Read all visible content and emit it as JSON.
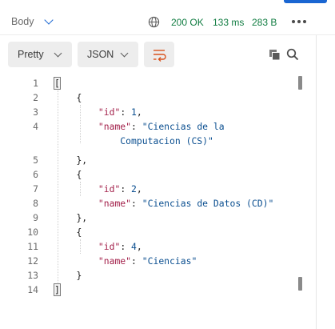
{
  "response_bar": {
    "body_tab_label": "Body",
    "status": "200 OK",
    "time": "133 ms",
    "size": "283 B",
    "icons": {
      "globe": "globe-icon",
      "more": "more-options-icon",
      "chevron": "chevron-down-icon"
    }
  },
  "toolbar": {
    "format_dropdown": "Pretty",
    "language_dropdown": "JSON",
    "icons": {
      "wrap": "wrap-lines-icon",
      "copy": "copy-icon",
      "search": "search-icon"
    }
  },
  "colors": {
    "accent_blue": "#1a66d2",
    "status_green": "#107c41",
    "json_key": "#a3214b",
    "json_value": "#0b4f90"
  },
  "editor": {
    "line_numbers": [
      "1",
      "2",
      "3",
      "4",
      "5",
      "6",
      "7",
      "8",
      "9",
      "10",
      "11",
      "12",
      "13",
      "14"
    ],
    "lines": [
      {
        "indent": "",
        "text": "["
      },
      {
        "indent": "    ",
        "text": "{"
      },
      {
        "indent": "        ",
        "key": "\"id\"",
        "sep": ": ",
        "value": "1",
        "end": ","
      },
      {
        "indent": "        ",
        "key": "\"name\"",
        "sep": ": ",
        "value": "\"Ciencias de la",
        "end": ""
      },
      {
        "indent": "            ",
        "text_value": "Computacion (CS)\""
      },
      {
        "indent": "    ",
        "text": "},"
      },
      {
        "indent": "    ",
        "text": "{"
      },
      {
        "indent": "        ",
        "key": "\"id\"",
        "sep": ": ",
        "value": "2",
        "end": ","
      },
      {
        "indent": "        ",
        "key": "\"name\"",
        "sep": ": ",
        "value": "\"Ciencias de Datos (CD)\"",
        "end": ""
      },
      {
        "indent": "    ",
        "text": "},"
      },
      {
        "indent": "    ",
        "text": "{"
      },
      {
        "indent": "        ",
        "key": "\"id\"",
        "sep": ": ",
        "value": "4",
        "end": ","
      },
      {
        "indent": "        ",
        "key": "\"name\"",
        "sep": ": ",
        "value": "\"Ciencias\"",
        "end": ""
      },
      {
        "indent": "    ",
        "text": "}"
      },
      {
        "indent": "",
        "text": "]"
      }
    ]
  }
}
